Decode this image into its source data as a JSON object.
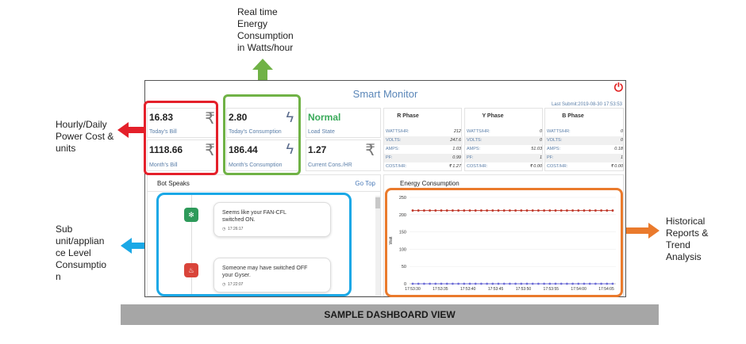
{
  "annotations": {
    "top": [
      "Real time",
      "Energy",
      "Consumption",
      "in Watts/hour"
    ],
    "left_top": [
      "Hourly/Daily",
      "Power Cost &",
      "units"
    ],
    "left_bottom": [
      "Sub",
      "unit/applian",
      "ce Level",
      "Consumptio",
      "n"
    ],
    "right": [
      "Historical",
      "Reports &",
      "Trend",
      "Analysis"
    ]
  },
  "colors": {
    "red": "#e4202a",
    "green": "#70b246",
    "blue": "#1aa8e6",
    "orange": "#ea7a2c"
  },
  "dashboard": {
    "title": "Smart Monitor",
    "last_submit": "Last Submit:2019-08-30 17:53:53",
    "cards": {
      "today_bill": {
        "value": "16.83",
        "label": "Today's Bill"
      },
      "month_bill": {
        "value": "1118.66",
        "label": "Month's Bill"
      },
      "today_consumption": {
        "value": "2.80",
        "label": "Today's Consumption"
      },
      "month_consumption": {
        "value": "186.44",
        "label": "Month's Consumption"
      },
      "load_state": {
        "value": "Normal",
        "label": "Load State"
      },
      "current_cons": {
        "value": "1.27",
        "label": "Current Cons./HR"
      }
    },
    "phases": [
      {
        "name": "R Phase",
        "rows": [
          [
            "WATTS/HR:",
            "212"
          ],
          [
            "VOLTS:",
            "247.6"
          ],
          [
            "AMPS:",
            "1.03"
          ],
          [
            "PF:",
            "0.99"
          ],
          [
            "COST/HR:",
            "₹ 1.27"
          ]
        ]
      },
      {
        "name": "Y Phase",
        "rows": [
          [
            "WATTS/HR:",
            "0"
          ],
          [
            "VOLTS:",
            "0"
          ],
          [
            "AMPS:",
            "51.03"
          ],
          [
            "PF:",
            "1"
          ],
          [
            "COST/HR:",
            "₹ 0.00"
          ]
        ]
      },
      {
        "name": "B Phase",
        "rows": [
          [
            "WATTS/HR:",
            "0"
          ],
          [
            "VOLTS:",
            "0"
          ],
          [
            "AMPS:",
            "0.18"
          ],
          [
            "PF:",
            "1"
          ],
          [
            "COST/HR:",
            "₹ 0.00"
          ]
        ]
      }
    ],
    "bot": {
      "title": "Bot Speaks",
      "go_top": "Go Top",
      "messages": [
        {
          "text1": "Seems like your FAN-CFL",
          "text2": "switched ON.",
          "time": "17:26:17",
          "icon": "fan-icon"
        },
        {
          "text1": "Someone may have switched OFF",
          "text2": "your Gyser.",
          "time": "17:22:07",
          "icon": "geyser-icon"
        }
      ]
    }
  },
  "chart_data": {
    "type": "line",
    "title": "Energy Consumption",
    "ylabel": "Watt",
    "ylim": [
      0,
      250
    ],
    "yticks": [
      0,
      50,
      100,
      150,
      200,
      250
    ],
    "categories": [
      "17:53:30",
      "17:53:35",
      "17:53:40",
      "17:53:45",
      "17:53:50",
      "17:53:55",
      "17:54:00",
      "17:54:05"
    ],
    "series": [
      {
        "color": "#c0392b",
        "values": [
          212,
          212,
          212,
          212,
          212,
          212,
          212,
          212,
          212,
          212,
          212,
          212,
          212,
          212,
          212,
          212,
          212,
          212,
          212,
          212,
          212,
          212,
          212,
          212,
          212,
          212,
          212,
          212,
          212,
          212,
          212,
          212,
          212,
          212,
          212,
          212
        ]
      },
      {
        "color": "#6b6bd6",
        "values": [
          0,
          0,
          0,
          0,
          0,
          0,
          0,
          0,
          0,
          0,
          0,
          0,
          0,
          0,
          0,
          0,
          0,
          0,
          0,
          0,
          0,
          0,
          0,
          0,
          0,
          0,
          0,
          0,
          0,
          0,
          0,
          0,
          0,
          0,
          0,
          0
        ]
      }
    ]
  },
  "banner": "SAMPLE DASHBOARD VIEW"
}
